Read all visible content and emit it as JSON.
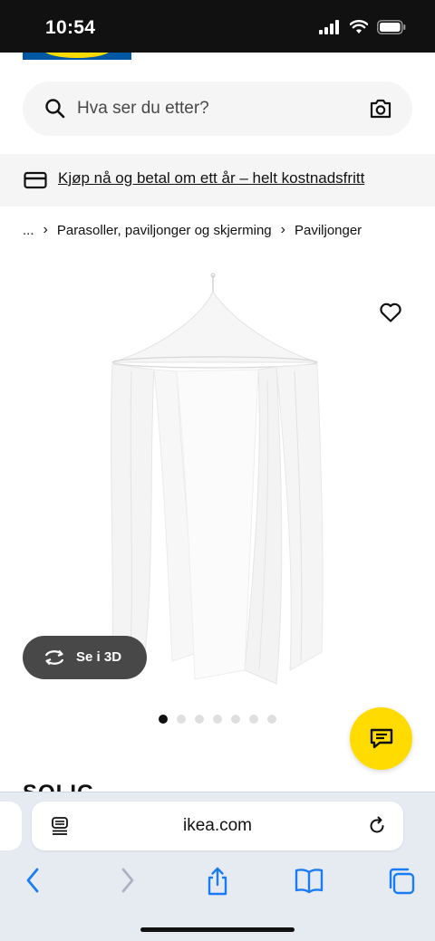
{
  "status_bar": {
    "time": "10:54"
  },
  "search": {
    "placeholder": "Hva ser du etter?"
  },
  "promo": {
    "text": "Kjøp nå og betal om ett år – helt kostnadsfritt"
  },
  "breadcrumb": {
    "items": [
      "...",
      "Parasoller, paviljonger og skjerming",
      "Paviljonger"
    ]
  },
  "product": {
    "view3d_label": "Se i 3D",
    "carousel_total": 7,
    "carousel_active": 0,
    "name": "SOLIG"
  },
  "browser": {
    "url": "ikea.com"
  },
  "colors": {
    "brand_blue": "#0058a3",
    "brand_yellow": "#ffdb00",
    "ios_blue": "#1a7cf5"
  },
  "icons": [
    "search-icon",
    "camera-icon",
    "card-icon",
    "heart-icon",
    "rotate-3d-icon",
    "chat-icon",
    "reader-icon",
    "reload-icon",
    "back-icon",
    "forward-icon",
    "share-icon",
    "bookmarks-icon",
    "tabs-icon"
  ]
}
